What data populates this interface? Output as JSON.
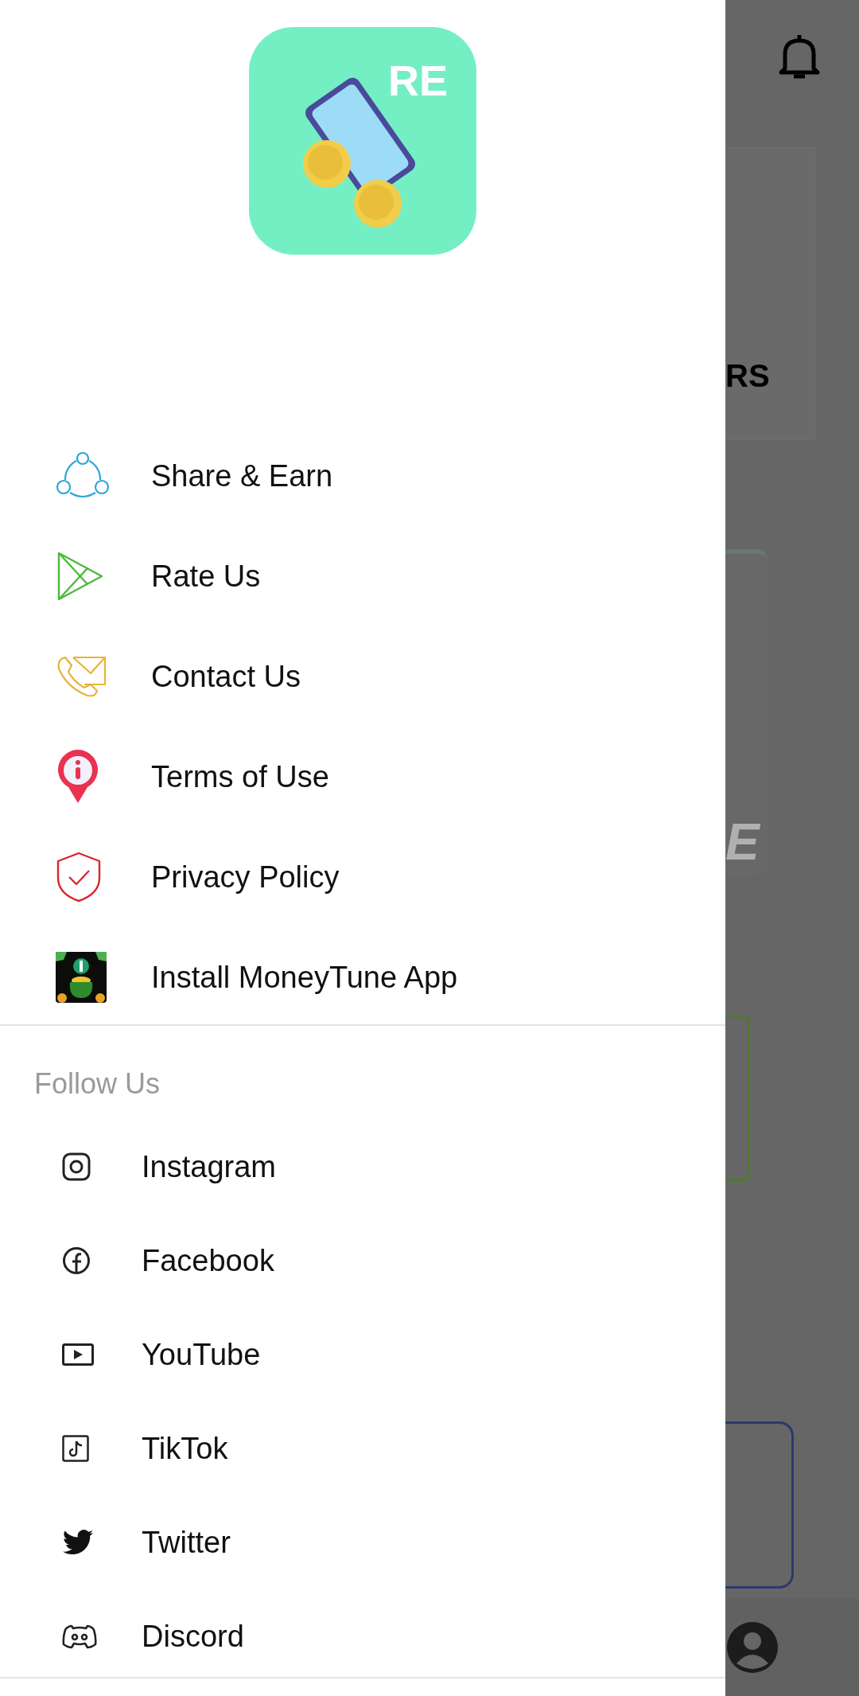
{
  "logo": {
    "text": "RE"
  },
  "menu": [
    {
      "label": "Share & Earn",
      "kind": "share"
    },
    {
      "label": "Rate Us",
      "kind": "play"
    },
    {
      "label": "Contact Us",
      "kind": "contact"
    },
    {
      "label": "Terms of Use",
      "kind": "info"
    },
    {
      "label": "Privacy Policy",
      "kind": "shield"
    },
    {
      "label": "Install MoneyTune App",
      "kind": "app"
    }
  ],
  "follow": {
    "heading": "Follow Us",
    "items": [
      {
        "label": "Instagram",
        "kind": "instagram"
      },
      {
        "label": "Facebook",
        "kind": "facebook"
      },
      {
        "label": "YouTube",
        "kind": "youtube"
      },
      {
        "label": "TikTok",
        "kind": "tiktok"
      },
      {
        "label": "Twitter",
        "kind": "twitter"
      },
      {
        "label": "Discord",
        "kind": "discord"
      }
    ]
  },
  "background": {
    "card_text": "RS",
    "banner_text": "E"
  }
}
